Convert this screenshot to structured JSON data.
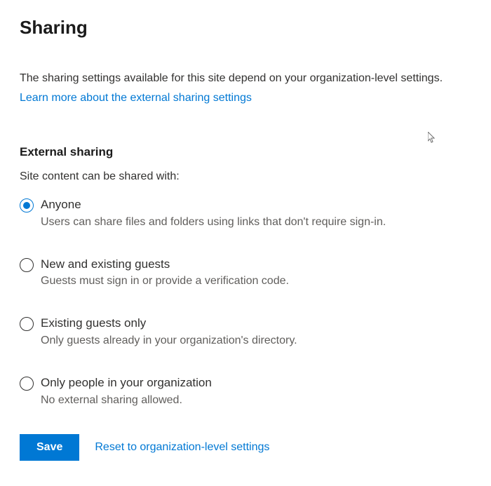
{
  "title": "Sharing",
  "intro": "The sharing settings available for this site depend on your organization-level settings.",
  "learn_more": "Learn more about the external sharing settings",
  "section": {
    "heading": "External sharing",
    "subheading": "Site content can be shared with:"
  },
  "options": [
    {
      "label": "Anyone",
      "description": "Users can share files and folders using links that don't require sign-in.",
      "selected": true
    },
    {
      "label": "New and existing guests",
      "description": "Guests must sign in or provide a verification code.",
      "selected": false
    },
    {
      "label": "Existing guests only",
      "description": "Only guests already in your organization's directory.",
      "selected": false
    },
    {
      "label": "Only people in your organization",
      "description": "No external sharing allowed.",
      "selected": false
    }
  ],
  "actions": {
    "save": "Save",
    "reset": "Reset to organization-level settings"
  },
  "colors": {
    "accent": "#0078d4"
  }
}
